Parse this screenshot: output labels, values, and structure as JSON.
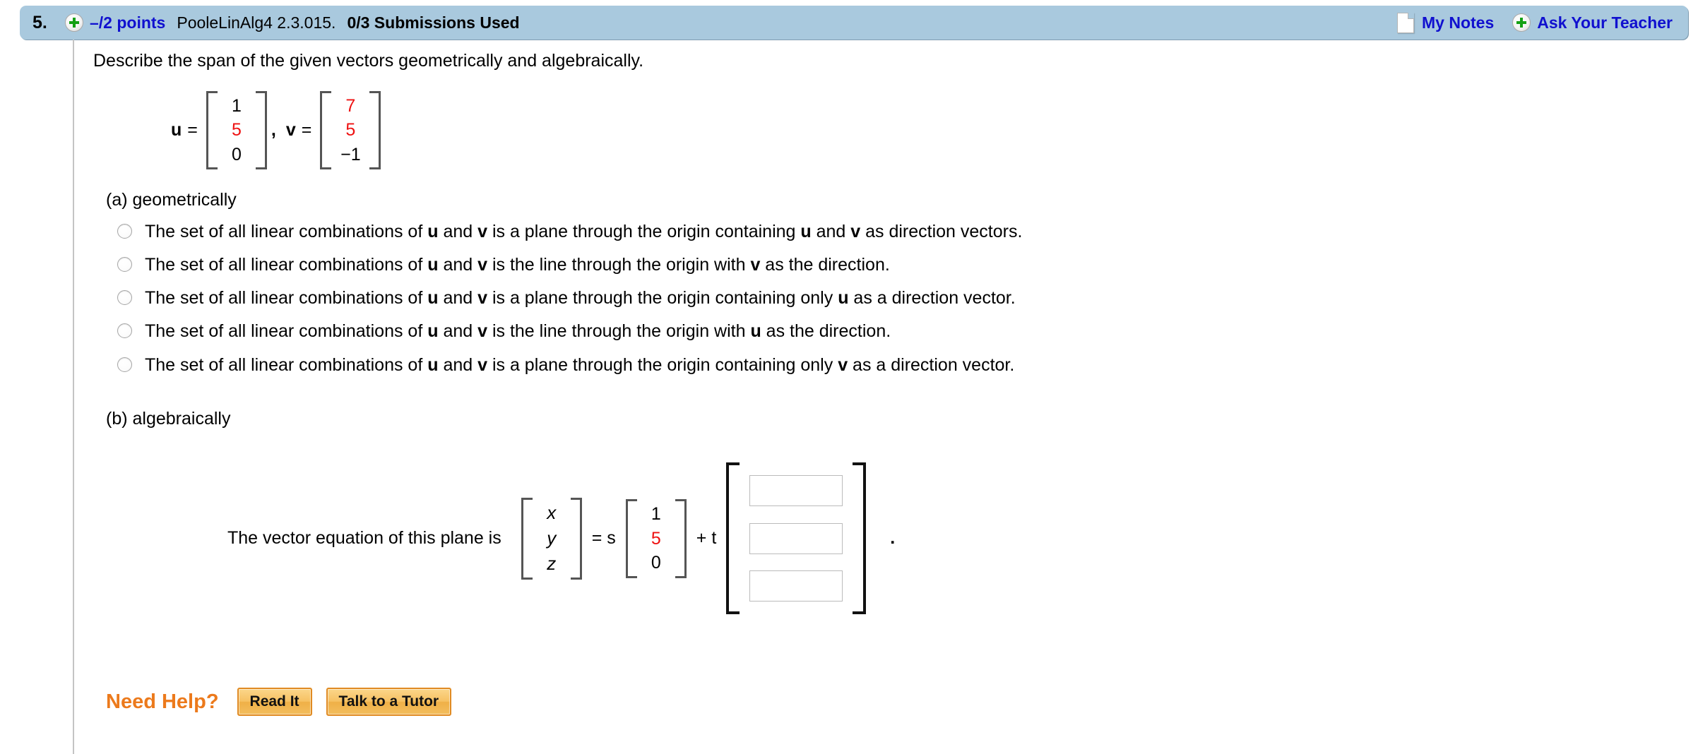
{
  "header": {
    "question_number": "5.",
    "plus_icon": "plus-circle-icon",
    "points": "–/2 points",
    "question_key": "PooleLinAlg4 2.3.015.",
    "submissions": "0/3 Submissions Used",
    "notes_icon": "note-page-icon",
    "my_notes_label": "My Notes",
    "ask_plus_icon": "plus-circle-icon",
    "ask_teacher_label": "Ask Your Teacher",
    "bar_color": "#a9c9de",
    "link_color": "#1010cf"
  },
  "question": {
    "prompt": "Describe the span of the given vectors geometrically and algebraically.",
    "vectors": [
      {
        "name": "u",
        "equals": "=",
        "entries": [
          {
            "value": "1",
            "color": "black"
          },
          {
            "value": "5",
            "color": "red"
          },
          {
            "value": "0",
            "color": "black"
          }
        ]
      },
      {
        "name": "v",
        "equals": "=",
        "entries": [
          {
            "value": "7",
            "color": "red"
          },
          {
            "value": "5",
            "color": "red"
          },
          {
            "value": "−1",
            "color": "black"
          }
        ]
      }
    ],
    "separator": ","
  },
  "part_a": {
    "label": "(a) geometrically",
    "choices": [
      {
        "pre": "The set of all linear combinations of ",
        "b1": "u",
        "mid1": " and ",
        "b2": "v",
        "mid2": " is a plane through the origin containing ",
        "b3": "u",
        "mid3": " and ",
        "b4": "v",
        "post": " as direction vectors.",
        "selected": false
      },
      {
        "pre": "The set of all linear combinations of ",
        "b1": "u",
        "mid1": " and ",
        "b2": "v",
        "mid2": " is the line through the origin with ",
        "b3": "v",
        "mid3": "",
        "b4": "",
        "post": " as the direction.",
        "selected": false
      },
      {
        "pre": "The set of all linear combinations of ",
        "b1": "u",
        "mid1": " and ",
        "b2": "v",
        "mid2": " is a plane through the origin containing only ",
        "b3": "u",
        "mid3": "",
        "b4": "",
        "post": " as a direction vector.",
        "selected": false
      },
      {
        "pre": "The set of all linear combinations of ",
        "b1": "u",
        "mid1": " and ",
        "b2": "v",
        "mid2": " is the line through the origin with ",
        "b3": "u",
        "mid3": "",
        "b4": "",
        "post": " as the direction.",
        "selected": false
      },
      {
        "pre": "The set of all linear combinations of ",
        "b1": "u",
        "mid1": " and ",
        "b2": "v",
        "mid2": " is a plane through the origin containing only ",
        "b3": "v",
        "mid3": "",
        "b4": "",
        "post": " as a direction vector.",
        "selected": false
      }
    ]
  },
  "part_b": {
    "label": "(b) algebraically",
    "lead_text": "The vector equation of this plane is",
    "lhs_entries": [
      "x",
      "y",
      "z"
    ],
    "equals_s": "= s",
    "coeff_entries": [
      {
        "value": "1",
        "color": "black"
      },
      {
        "value": "5",
        "color": "red"
      },
      {
        "value": "0",
        "color": "black"
      }
    ],
    "plus_t": "+ t",
    "answer_boxes": [
      {
        "value": "",
        "placeholder": ""
      },
      {
        "value": "",
        "placeholder": ""
      },
      {
        "value": "",
        "placeholder": ""
      }
    ],
    "trailing_period": "."
  },
  "footer": {
    "need_help_label": "Need Help?",
    "buttons": [
      {
        "label": "Read It"
      },
      {
        "label": "Talk to a Tutor"
      }
    ],
    "accent_color": "#ec7a1c"
  }
}
